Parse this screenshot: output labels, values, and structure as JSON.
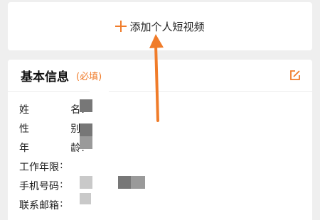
{
  "video_card": {
    "add_label": "添加个人短视频"
  },
  "info_card": {
    "title": "基本信息",
    "required": "(必填)",
    "fields": [
      {
        "label_a": "姓",
        "label_b": "名",
        "colon": ":"
      },
      {
        "label_a": "性",
        "label_b": "别",
        "colon": ":"
      },
      {
        "label_a": "年",
        "label_b": "龄",
        "colon": ":"
      },
      {
        "label_wide": "工作年限",
        "colon": ":"
      },
      {
        "label_wide": "手机号码",
        "colon": ":"
      },
      {
        "label_wide": "联系邮箱",
        "colon": ":"
      }
    ]
  },
  "colors": {
    "accent": "#f07c2a",
    "card_bg": "#ffffff",
    "page_bg": "#efefef",
    "text": "#222222"
  },
  "icons": {
    "add": "plus-icon",
    "edit": "edit-icon",
    "arrow": "arrow-up-icon"
  }
}
